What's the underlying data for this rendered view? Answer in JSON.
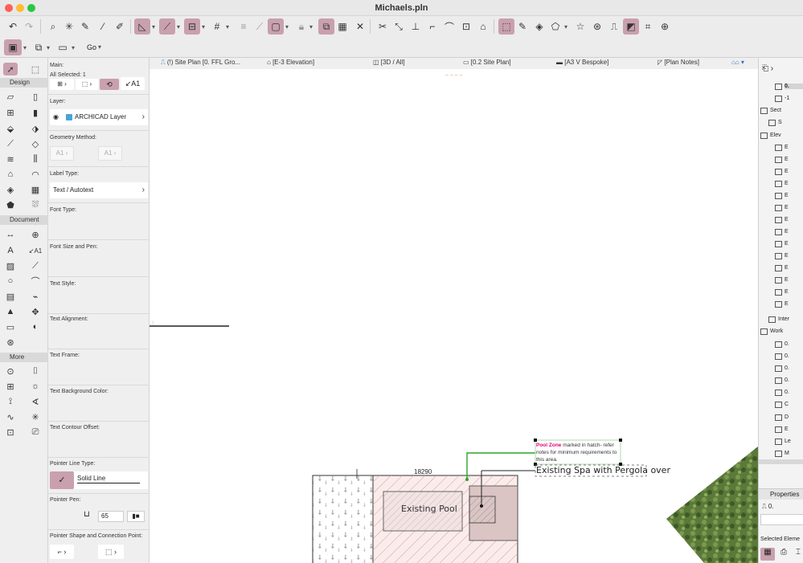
{
  "window": {
    "title": "Michaels.pln"
  },
  "colors": {
    "accent": "#c9a0ae",
    "pink_text": "#e4007c",
    "green_line": "#2aa52a",
    "traffic_red": "#fe5f57",
    "traffic_yellow": "#febc2e",
    "traffic_green": "#28c840"
  },
  "toolbar2": {
    "go_label": "Go"
  },
  "toolbox": {
    "design_header": "Design",
    "document_header": "Document",
    "more_header": "More"
  },
  "info_box": {
    "main_label": "Main:",
    "all_selected": "All Selected: 1",
    "label_tool_text": "A1",
    "layer_label": "Layer:",
    "layer_value": "ARCHICAD Layer",
    "geometry_label": "Geometry Method:",
    "label_type_label": "Label Type:",
    "label_type_value": "Text / Autotext",
    "font_type_label": "Font Type:",
    "font_size_label": "Font Size and Pen:",
    "text_style_label": "Text Style:",
    "text_alignment_label": "Text Alignment:",
    "text_frame_label": "Text Frame:",
    "text_bg_label": "Text Background Color:",
    "text_contour_label": "Text Contour Offset:",
    "pointer_line_label": "Pointer Line Type:",
    "pointer_line_value": "Solid Line",
    "pointer_pen_label": "Pointer Pen:",
    "pointer_pen_value": "65",
    "pointer_shape_label": "Pointer Shape and Connection Point:"
  },
  "tabs": [
    {
      "label": "(!) Site Plan [0. FFL Gro..."
    },
    {
      "label": "[E-3 Elevation]"
    },
    {
      "label": "[3D / All]"
    },
    {
      "label": "[0.2 Site Plan]"
    },
    {
      "label": "[A3 V Bespoke]"
    },
    {
      "label": "[Plan Notes]"
    }
  ],
  "drawing": {
    "dimension": "18290",
    "pool_label": "Existing Pool",
    "spa_label": "Existing Spa with Pergola over",
    "note_highlight": "Pool Zone",
    "note_line1": " marked in hatch- refer",
    "note_line2": "notes for minimum requirements to",
    "note_line3": "this area."
  },
  "navigator": {
    "items": [
      "0.",
      "-1",
      "Sect",
      "S",
      "Elev",
      "E",
      "E",
      "E",
      "E",
      "E",
      "E",
      "E",
      "E",
      "E",
      "E",
      "E",
      "E",
      "E",
      "E",
      "Inter",
      "Work",
      "0.",
      "0.",
      "0.",
      "0.",
      "0.",
      "C",
      "D",
      "E",
      "Le",
      "M"
    ],
    "properties_label": "Properties",
    "properties_value": "0.",
    "selected_label": "Selected Eleme"
  }
}
